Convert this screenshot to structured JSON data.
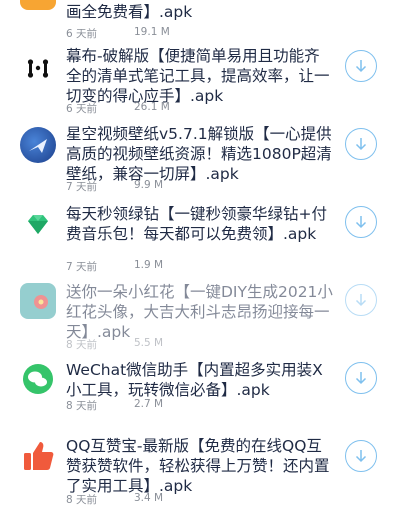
{
  "items": [
    {
      "title": "画全免费看】.apk",
      "time": "6 天前",
      "size": "19.1 M",
      "icon": "orange-app-icon"
    },
    {
      "title": "幕布-破解版【便捷简单易用且功能齐全的清单式笔记工具，提高效率，让一切变的得心应手】.apk",
      "time": "6 天前",
      "size": "26.1 M",
      "icon": "mubu-logo-icon"
    },
    {
      "title": "星空视频壁纸v5.7.1解锁版【一心提供高质的视频壁纸资源！精选1080P超清壁纸，兼容一切屏】.apk",
      "time": "7 天前",
      "size": "9.9 M",
      "icon": "starry-sky-icon"
    },
    {
      "title": "每天秒领绿钻【一键秒领豪华绿钻+付费音乐包！每天都可以免费领】.apk",
      "time": "7 天前",
      "size": "1.9 M",
      "icon": "green-diamond-icon"
    },
    {
      "title": "送你一朵小红花【一键DIY生成2021小红花头像，大吉大利斗志昂扬迎接每一天】.apk",
      "time": "8 天前",
      "size": "5.5 M",
      "icon": "red-flower-icon"
    },
    {
      "title": "WeChat微信助手【内置超多实用装X小工具，玩转微信必备】.apk",
      "time": "8 天前",
      "size": "2.7 M",
      "icon": "wechat-icon"
    },
    {
      "title": "QQ互赞宝-最新版【免费的在线QQ互赞获赞软件，轻松获得上万赞！还内置了实用工具】.apk",
      "time": "8 天前",
      "size": "3.4 M",
      "icon": "thumbs-up-icon"
    }
  ]
}
